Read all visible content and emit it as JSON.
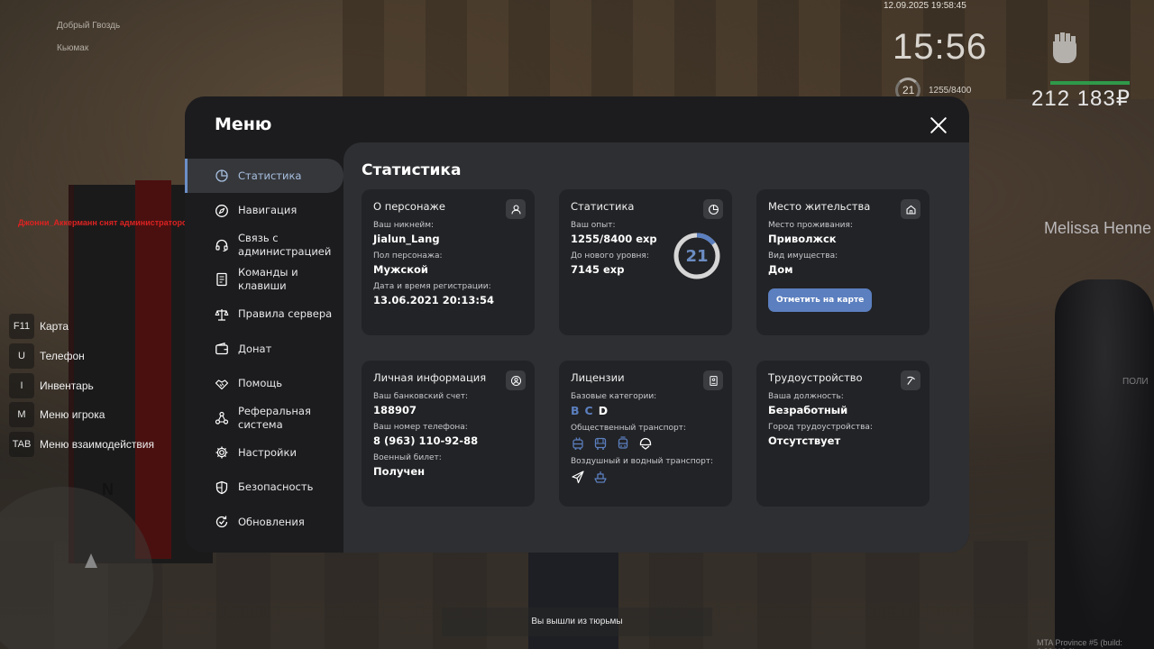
{
  "hud": {
    "top_left_line1": "Добрый Гвоздь",
    "top_left_line2": "Кьюмак",
    "datetime": "12.09.2025 19:58:45",
    "clock": "15:56",
    "level": "21",
    "exp": "1255/8400",
    "money": "212 183₽",
    "player_tag": "Melissa Henne",
    "police_tag": "ПОЛИ",
    "admin_message": "Джонни_Аккерманн снят администратором Melissa_Pringtons (АФК режим)",
    "status_message": "Вы вышли из тюрьмы",
    "build_info": "MTA Province #5 (build: 6.32418.9)",
    "compass": "N",
    "health_color": "#2f9a4a"
  },
  "keys": [
    {
      "key": "F11",
      "label": "Карта"
    },
    {
      "key": "U",
      "label": "Телефон"
    },
    {
      "key": "I",
      "label": "Инвентарь"
    },
    {
      "key": "M",
      "label": "Меню игрока"
    },
    {
      "key": "TAB",
      "label": "Меню взаимодействия"
    }
  ],
  "menu": {
    "title": "Меню",
    "accent_color": "#5b7fbf",
    "sidebar": [
      {
        "label": "Статистика",
        "icon": "pie-chart-icon"
      },
      {
        "label": "Навигация",
        "icon": "compass-icon"
      },
      {
        "label": "Связь с\nадминистрацией",
        "icon": "headset-icon"
      },
      {
        "label": "Команды и\nклавиши",
        "icon": "document-icon"
      },
      {
        "label": "Правила сервера",
        "icon": "scales-icon"
      },
      {
        "label": "Донат",
        "icon": "wallet-icon"
      },
      {
        "label": "Помощь",
        "icon": "handshake-icon"
      },
      {
        "label": "Реферальная\nсистема",
        "icon": "network-icon"
      },
      {
        "label": "Настройки",
        "icon": "gear-icon"
      },
      {
        "label": "Безопасность",
        "icon": "shield-icon"
      },
      {
        "label": "Обновления",
        "icon": "refresh-check-icon"
      }
    ],
    "content_title": "Статистика",
    "cards": {
      "character": {
        "title": "О персонаже",
        "icon": "user-icon",
        "nickname_label": "Ваш никнейм:",
        "nickname": "Jialun_Lang",
        "gender_label": "Пол персонажа:",
        "gender": "Мужской",
        "reg_label": "Дата и время регистрации:",
        "reg_value": "13.06.2021 20:13:54"
      },
      "stats": {
        "title": "Статистика",
        "icon": "pie-chart-icon",
        "exp_label": "Ваш опыт:",
        "exp_value": "1255/8400 exp",
        "next_label": "До нового уровня:",
        "next_value": "7145 exp",
        "level": "21",
        "level_progress": 0.149
      },
      "residence": {
        "title": "Место жительства",
        "icon": "home-icon",
        "place_label": "Место проживания:",
        "place_value": "Приволжск",
        "property_label": "Вид имущества:",
        "property_value": "Дом",
        "map_button": "Отметить на карте"
      },
      "personal": {
        "title": "Личная информация",
        "icon": "user-circle-icon",
        "bank_label": "Ваш банковский счет:",
        "bank_value": "188907",
        "phone_label": "Ваш номер телефона:",
        "phone_value": "8 (963) 110-92-88",
        "military_label": "Военный билет:",
        "military_value": "Получен"
      },
      "licenses": {
        "title": "Лицензии",
        "icon": "id-card-icon",
        "base_label": "Базовые категории:",
        "categories": [
          {
            "letter": "B",
            "active": true
          },
          {
            "letter": "C",
            "active": true
          },
          {
            "letter": "D",
            "active": false
          }
        ],
        "public_label": "Общественный транспорт:",
        "public_icons": [
          "trolleybus-icon",
          "bus-icon",
          "tram-icon",
          "helmet-icon"
        ],
        "air_label": "Воздушный и водный транспорт:",
        "air_icons": [
          "airplane-icon",
          "boat-icon"
        ]
      },
      "employment": {
        "title": "Трудоустройство",
        "icon": "pickaxe-icon",
        "position_label": "Ваша должность:",
        "position_value": "Безработный",
        "city_label": "Город трудоустройства:",
        "city_value": "Отсутствует"
      }
    }
  }
}
